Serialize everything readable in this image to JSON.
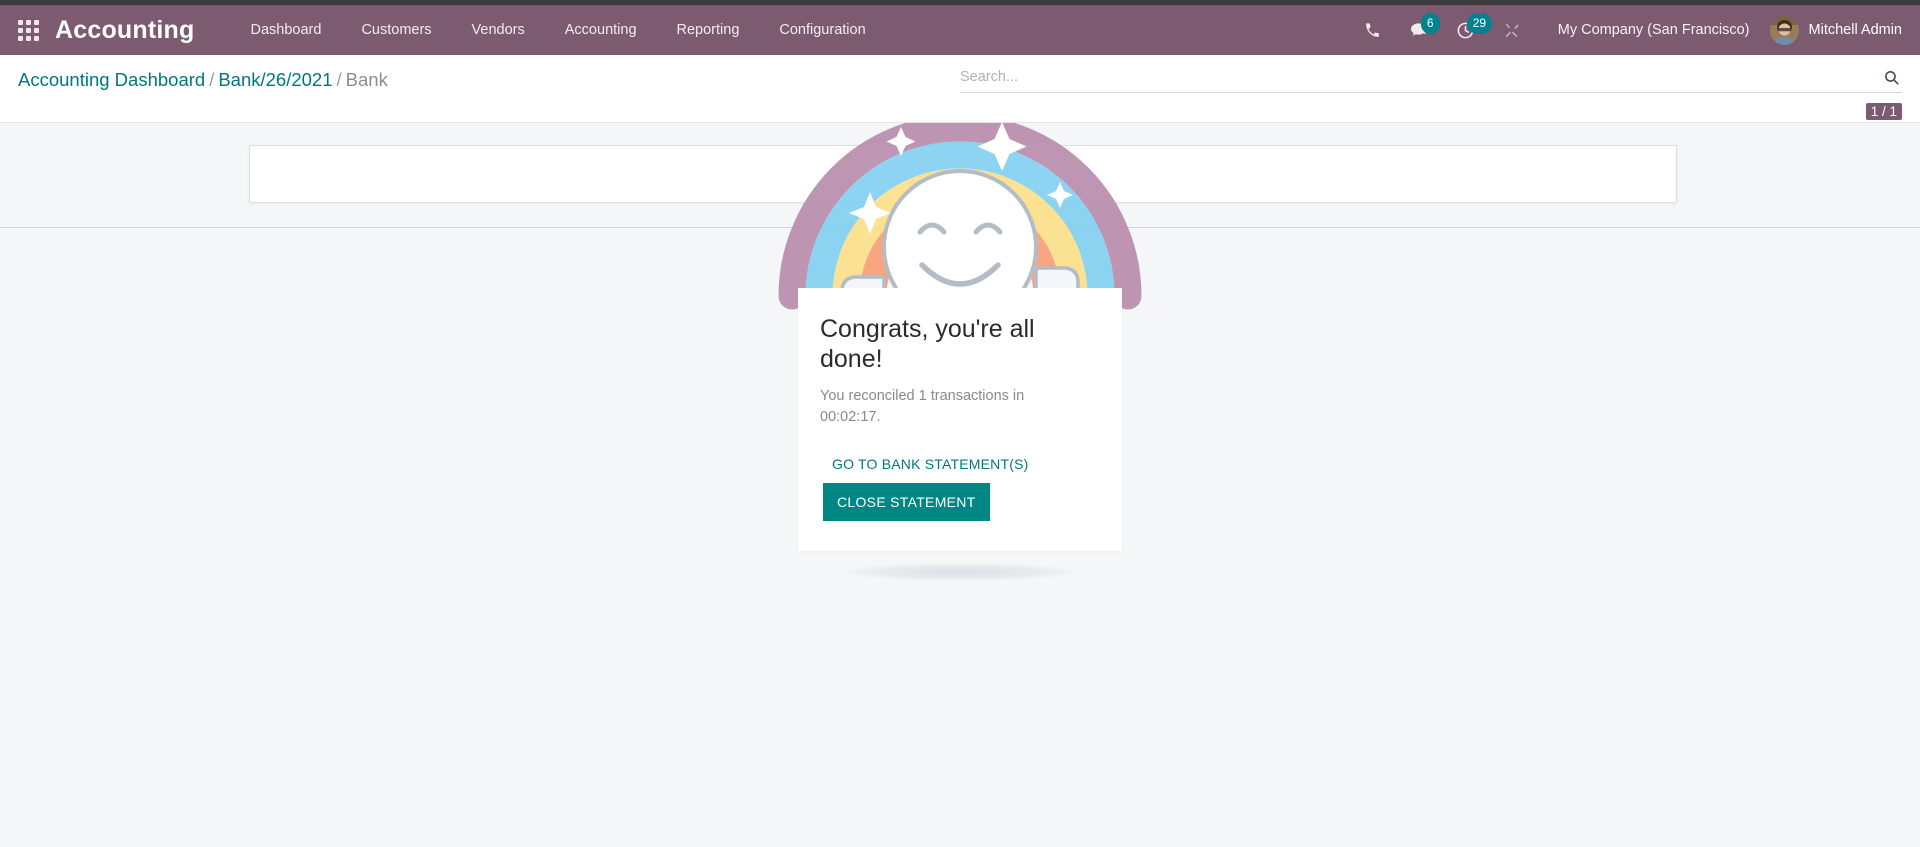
{
  "navbar": {
    "apps_icon": "apps-grid-icon",
    "brand": "Accounting",
    "menu": [
      {
        "label": "Dashboard"
      },
      {
        "label": "Customers"
      },
      {
        "label": "Vendors"
      },
      {
        "label": "Accounting"
      },
      {
        "label": "Reporting"
      },
      {
        "label": "Configuration"
      }
    ],
    "icons": {
      "phone": "phone-icon",
      "messages": "chat-bubble-icon",
      "activities": "clock-activity-icon",
      "debug": "tools-debug-icon"
    },
    "badges": {
      "messages_count": "6",
      "activities_count": "29"
    },
    "company": "My Company (San Francisco)",
    "user": "Mitchell Admin",
    "colors": {
      "navbar_bg": "#7c5a6f",
      "badge_bg": "#00838f",
      "top_strip": "#3b3b3b"
    }
  },
  "control_panel": {
    "breadcrumb": {
      "root": "Accounting Dashboard",
      "parent": "Bank/26/2021",
      "current": "Bank",
      "separator": "/"
    },
    "search": {
      "placeholder": "Search...",
      "value": "",
      "icon": "search-icon"
    },
    "pager": "1 / 1"
  },
  "rainbow_man": {
    "title": "Congrats, you're all done!",
    "message": "You reconciled 1 transactions in 00:02:17.",
    "link_label": "GO TO BANK STATEMENT(S)",
    "button_label": "CLOSE STATEMENT",
    "colors": {
      "arc_outer": "#b588a8",
      "arc_blue": "#7dcdf0",
      "arc_yellow": "#fcdf86",
      "arc_orange": "#fb9a72",
      "face": "#ffffff",
      "stroke": "#b4bcc6",
      "link": "#00777f",
      "button": "#008784"
    }
  }
}
